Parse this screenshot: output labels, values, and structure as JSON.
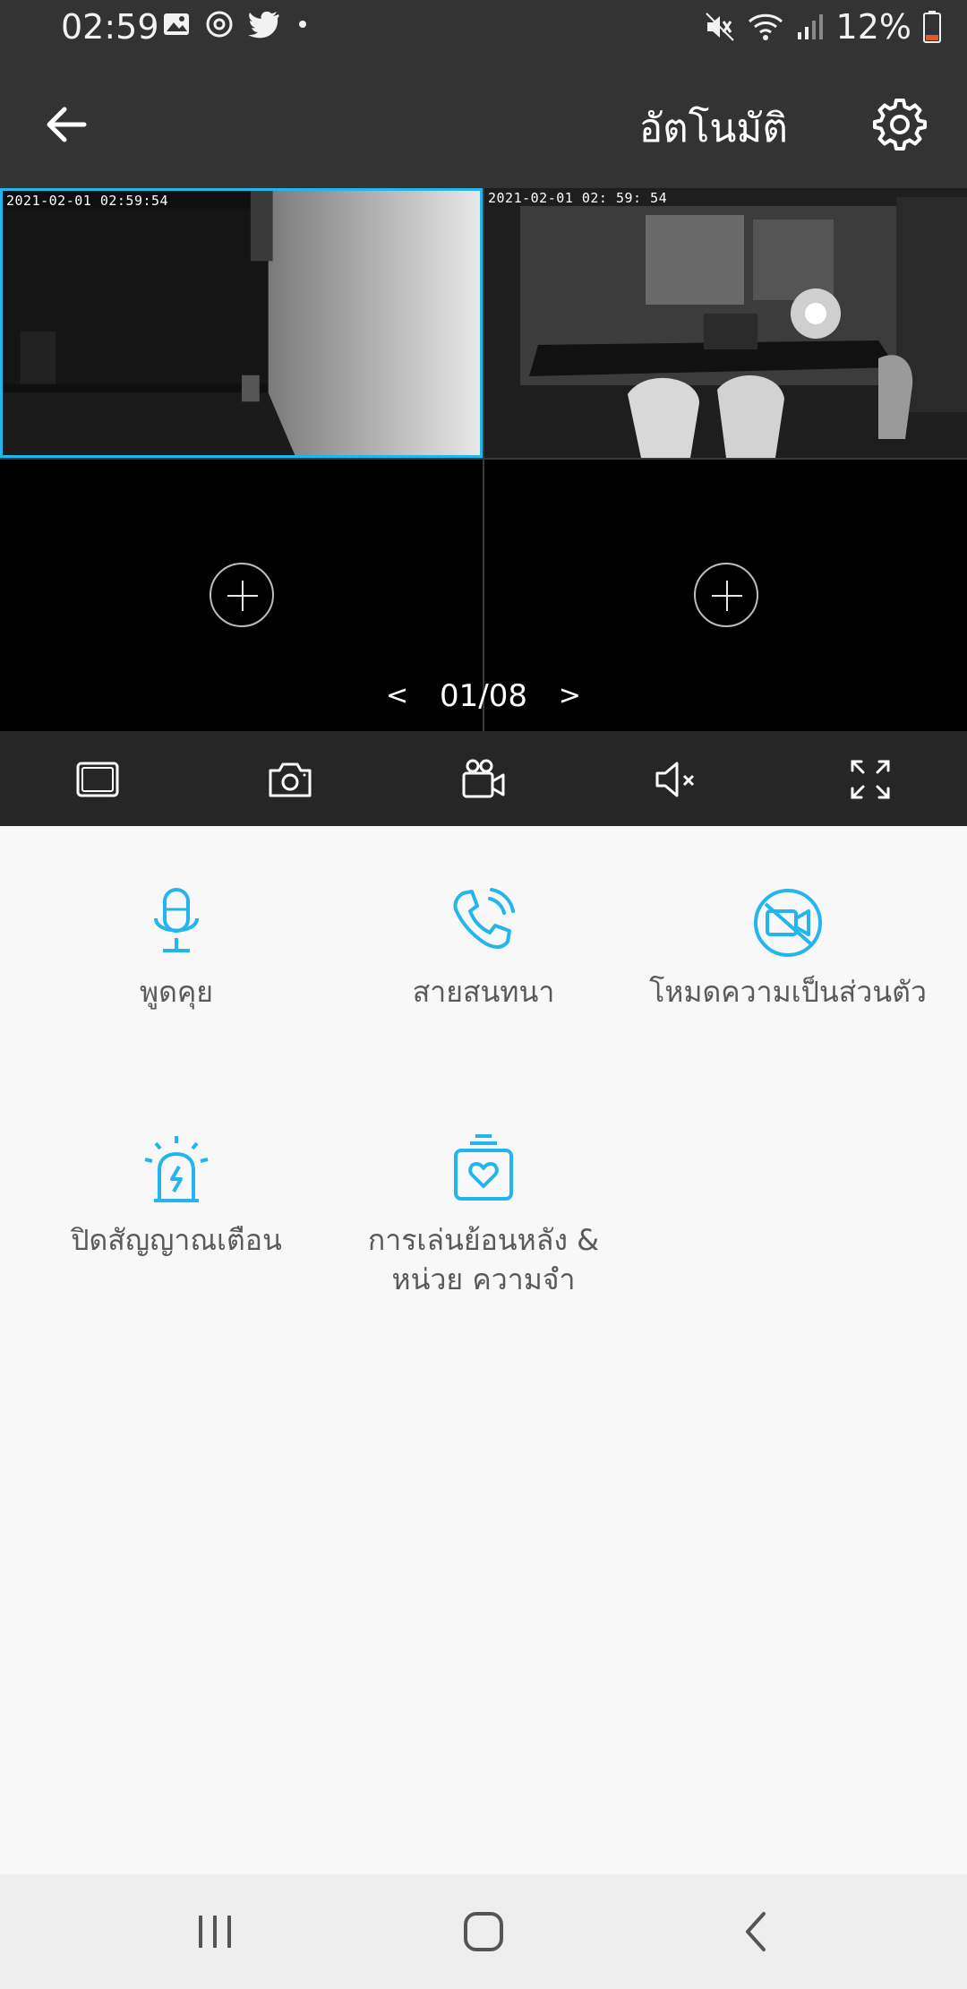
{
  "status_bar": {
    "time": "02:59",
    "battery": "12%",
    "icons_left": [
      "gallery-icon",
      "chat-icon",
      "twitter-icon",
      "dot-icon"
    ],
    "icons_right": [
      "mute-icon",
      "wifi-icon",
      "signal-icon",
      "battery-icon"
    ],
    "battery_color": "#e25a2b"
  },
  "app_bar": {
    "mode_title": "อัตโนมัติ"
  },
  "cameras": [
    {
      "timestamp": "2021-02-01 02:59:54",
      "selected": true
    },
    {
      "timestamp": "2021-02-01 02: 59: 54",
      "selected": false
    },
    {
      "empty": true
    },
    {
      "empty": true
    }
  ],
  "pager": {
    "prev": "<",
    "current": "01/08",
    "next": ">"
  },
  "toolbar": {
    "buttons": [
      "single-view-icon",
      "snapshot-icon",
      "record-icon",
      "mute-speaker-icon",
      "fullscreen-icon"
    ]
  },
  "functions": [
    {
      "label": "พูดคุย",
      "icon": "microphone-icon"
    },
    {
      "label": "สายสนทนา",
      "icon": "phone-call-icon"
    },
    {
      "label": "โหมดความเป็นส่วนตัว",
      "icon": "privacy-camera-off-icon"
    },
    {
      "label": "ปิดสัญญาณเตือน",
      "icon": "siren-icon"
    },
    {
      "label": "การเล่นย้อนหลัง & หน่วย ความจำ",
      "icon": "playback-memory-icon"
    }
  ],
  "colors": {
    "accent": "#25b5ee",
    "header": "#333333",
    "toolbar": "#262626",
    "content_bg": "#f8f8f8"
  }
}
